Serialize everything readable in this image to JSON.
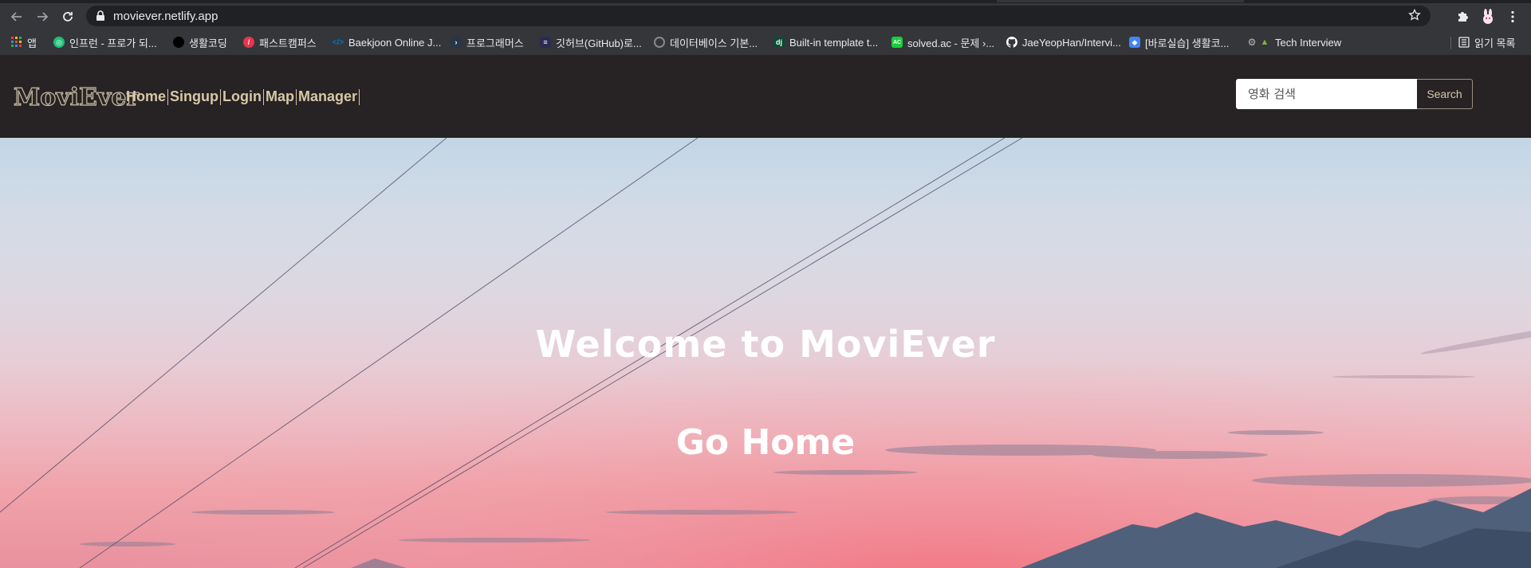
{
  "browser": {
    "url": "moviever.netlify.app",
    "bookmarks": [
      {
        "label": "앱",
        "icon": "apps-grid-icon",
        "color": "#ea4335"
      },
      {
        "label": "인프런 - 프로가 되...",
        "icon": "inflearn-icon",
        "color": "#1dc078"
      },
      {
        "label": "생활코딩",
        "icon": "opentutorials-icon",
        "color": "#000000"
      },
      {
        "label": "패스트캠퍼스",
        "icon": "fastcampus-icon",
        "color": "#e8344e"
      },
      {
        "label": "Baekjoon Online J...",
        "icon": "baekjoon-icon",
        "color": "#0076c0"
      },
      {
        "label": "프로그래머스",
        "icon": "programmers-icon",
        "color": "#263747"
      },
      {
        "label": "깃허브(GitHub)로...",
        "icon": "book-icon",
        "color": "#2b2b4f"
      },
      {
        "label": "데이터베이스 기본...",
        "icon": "circle-icon",
        "color": "#555555"
      },
      {
        "label": "Built-in template t...",
        "icon": "django-icon",
        "color": "#0c4b33"
      },
      {
        "label": "solved.ac - 문제 ›...",
        "icon": "solvedac-icon",
        "color": "#17ce3a"
      },
      {
        "label": "JaeYeopHan/Intervi...",
        "icon": "github-icon",
        "color": "#ffffff"
      },
      {
        "label": "[바로실습] 생활코...",
        "icon": "shield-icon",
        "color": "#4285f4"
      },
      {
        "label": "Tech Interview",
        "icon": "tech-icon",
        "color": "#888888"
      }
    ],
    "reading_list": "읽기 목록"
  },
  "site": {
    "logo": "MoviEver",
    "menu": [
      "Home",
      "Singup",
      "Login",
      "Map",
      "Manager"
    ],
    "search": {
      "placeholder": "영화 검색",
      "button": "Search"
    }
  },
  "hero": {
    "title": "Welcome to MoviEver",
    "link": "Go Home"
  },
  "colors": {
    "nav_bg": "#272223",
    "menu_text": "#d7c8a7",
    "chrome_bg": "#35363a"
  }
}
